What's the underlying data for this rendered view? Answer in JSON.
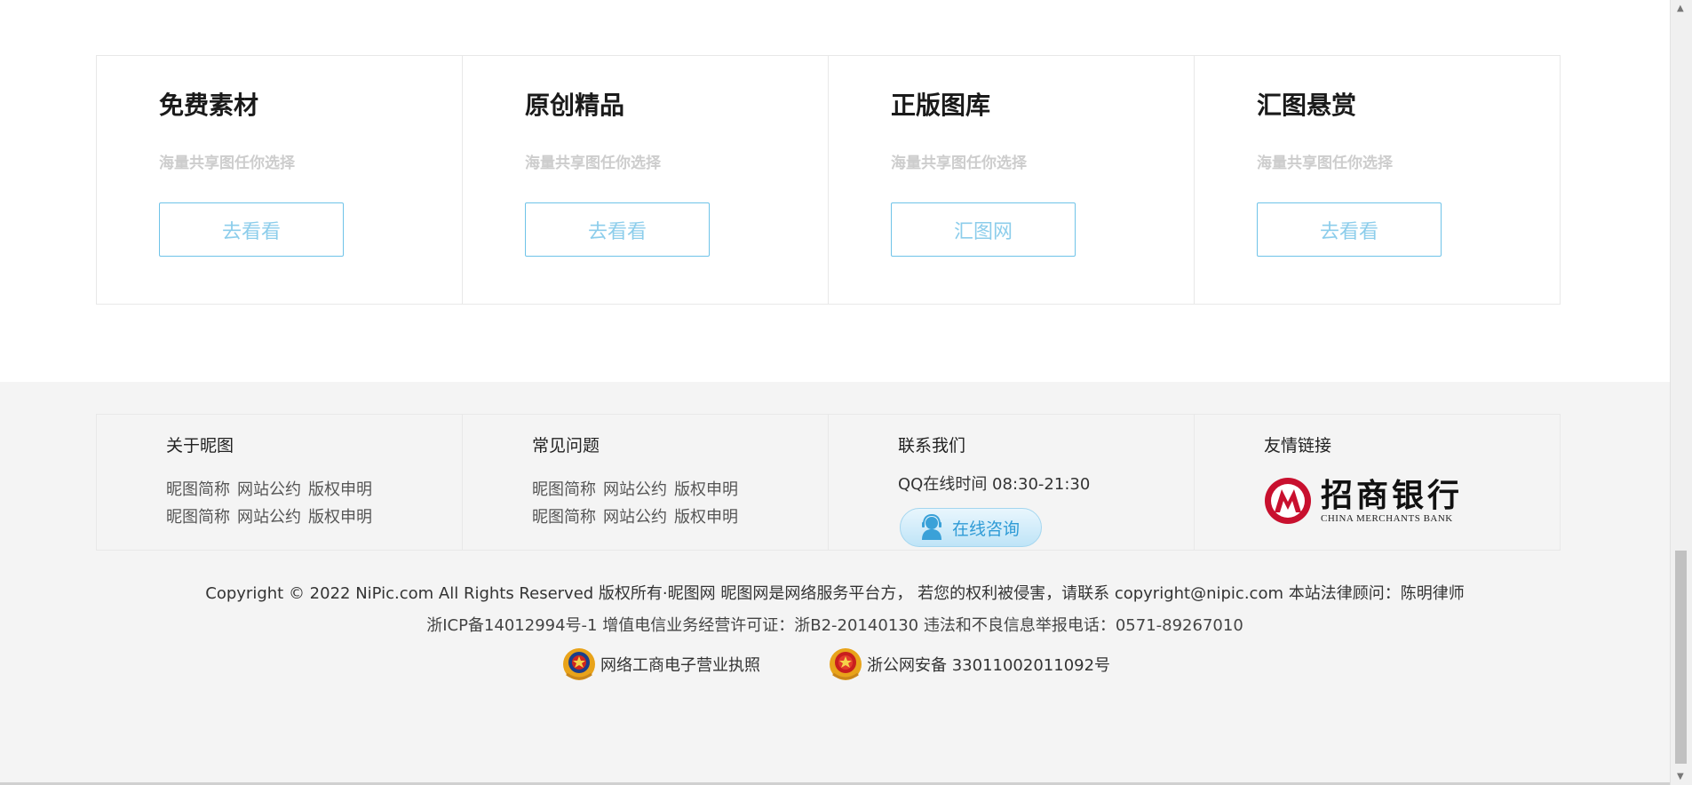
{
  "cards": [
    {
      "title": "免费素材",
      "subtitle": "海量共享图任你选择",
      "button": "去看看"
    },
    {
      "title": "原创精品",
      "subtitle": "海量共享图任你选择",
      "button": "去看看"
    },
    {
      "title": "正版图库",
      "subtitle": "海量共享图任你选择",
      "button": "汇图网"
    },
    {
      "title": "汇图悬赏",
      "subtitle": "海量共享图任你选择",
      "button": "去看看"
    }
  ],
  "footer": {
    "about": {
      "title": "关于昵图",
      "rows": [
        [
          "昵图简称",
          "网站公约",
          "版权申明"
        ],
        [
          "昵图简称",
          "网站公约",
          "版权申明"
        ]
      ]
    },
    "faq": {
      "title": "常见问题",
      "rows": [
        [
          "昵图简称",
          "网站公约",
          "版权申明"
        ],
        [
          "昵图简称",
          "网站公约",
          "版权申明"
        ]
      ]
    },
    "contact": {
      "title": "联系我们",
      "qq_time": "QQ在线时间 08:30-21:30",
      "consult_label": "在线咨询"
    },
    "friends": {
      "title": "友情链接",
      "bank_cn": "招商银行",
      "bank_en": "CHINA MERCHANTS BANK"
    },
    "copyright_line1": "Copyright © 2022 NiPic.com All Rights Reserved 版权所有·昵图网 昵图网是网络服务平台方， 若您的权利被侵害，请联系 copyright@nipic.com 本站法律顾问：陈明律师",
    "copyright_line2": "浙ICP备14012994号-1 增值电信业务经营许可证：浙B2-20140130 违法和不良信息举报电话：0571-89267010",
    "badge_business": "网络工商电子营业执照",
    "badge_police": "浙公网安备 33011002011092号"
  },
  "icons": {
    "consult": "headset-person-icon",
    "bank": "cmb-logo-icon",
    "business": "police-emblem-icon",
    "police": "police-emblem-icon"
  },
  "colors": {
    "accent_blue": "#6fc3e8",
    "bank_red": "#c8102e",
    "footer_bg": "#f4f4f4"
  }
}
